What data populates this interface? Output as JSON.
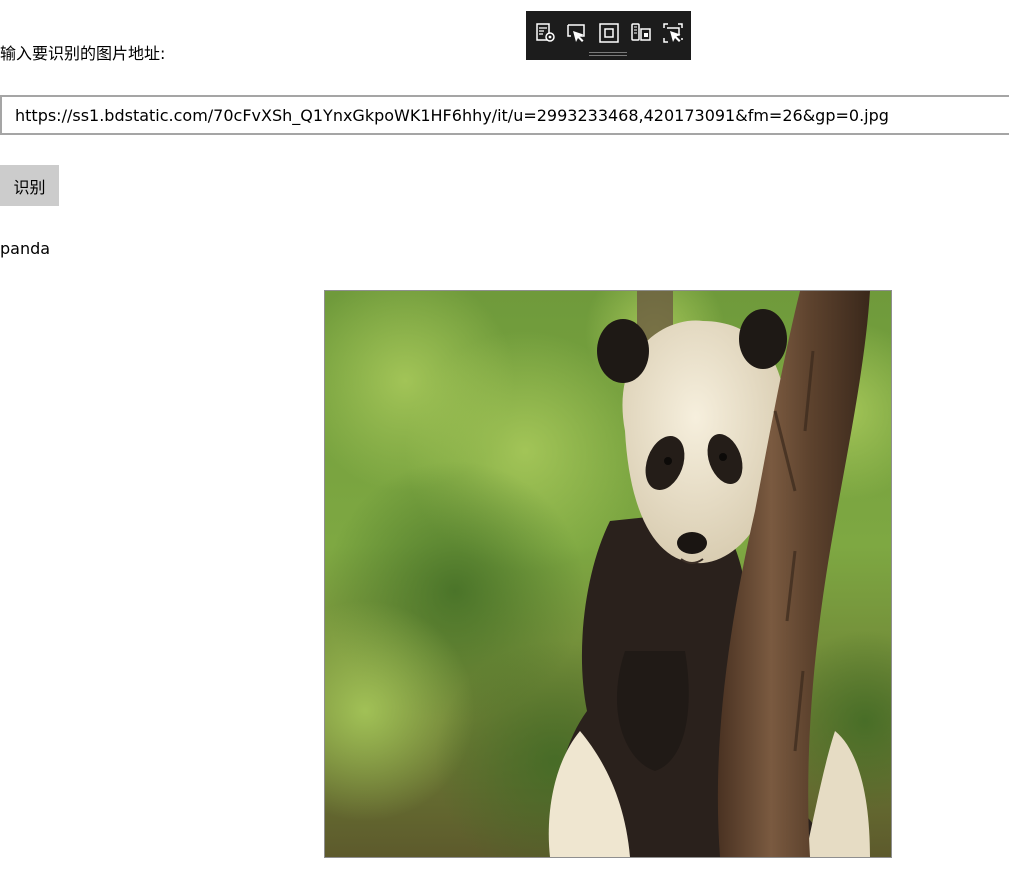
{
  "form": {
    "prompt_label": "输入要识别的图片地址:",
    "url_value": "https://ss1.bdstatic.com/70cFvXSh_Q1YnxGkpoWK1HF6hhy/it/u=2993233468,420173091&fm=26&gp=0.jpg",
    "recognize_label": "识别"
  },
  "result": {
    "label": "panda"
  },
  "image": {
    "subject": "giant panda hugging a tree trunk"
  },
  "debug_toolbar": {
    "buttons": [
      {
        "icon": "live-visual-tree-icon"
      },
      {
        "icon": "select-element-icon"
      },
      {
        "icon": "display-layout-adorners-icon"
      },
      {
        "icon": "track-focused-element-icon"
      },
      {
        "icon": "binding-failures-icon"
      }
    ]
  },
  "colors": {
    "toolbar_bg": "#1c1c1c",
    "button_bg": "#cccccc",
    "input_border": "#a5a5a5"
  }
}
